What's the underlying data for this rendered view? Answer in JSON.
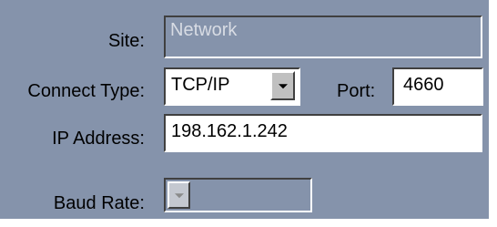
{
  "labels": {
    "site": "Site:",
    "connect_type": "Connect Type:",
    "port": "Port:",
    "ip_address": "IP Address:",
    "baud_rate": "Baud Rate:"
  },
  "fields": {
    "site_value": "Network",
    "connect_type_value": "TCP/IP",
    "port_value": "4660",
    "ip_address_value": "198.162.1.242",
    "baud_rate_value": ""
  },
  "icons": {
    "connect_type_dropdown": "chevron-down-icon",
    "baud_rate_dropdown": "chevron-down-icon"
  },
  "colors": {
    "panel_background": "#8593ab",
    "disabled_text": "#d8dce4"
  }
}
